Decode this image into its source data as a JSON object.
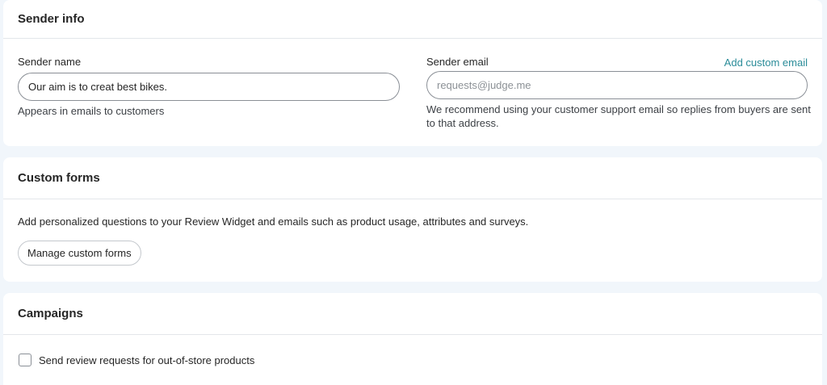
{
  "sender_info": {
    "title": "Sender info",
    "name_label": "Sender name",
    "name_value": "Our aim is to creat best bikes.",
    "name_help": "Appears in emails to customers",
    "email_label": "Sender email",
    "email_placeholder": "requests@judge.me",
    "email_value": "",
    "add_custom_email": "Add custom email",
    "email_help_line1": "We recommend using your customer support email so replies from buyers are sent",
    "email_help_line2": "to that address."
  },
  "custom_forms": {
    "title": "Custom forms",
    "description": "Add personalized questions to your Review Widget and emails such as product usage, attributes and surveys.",
    "manage_button": "Manage custom forms"
  },
  "campaigns": {
    "title": "Campaigns",
    "checkbox_label": "Send review requests for out-of-store products",
    "checkbox_checked": false
  }
}
